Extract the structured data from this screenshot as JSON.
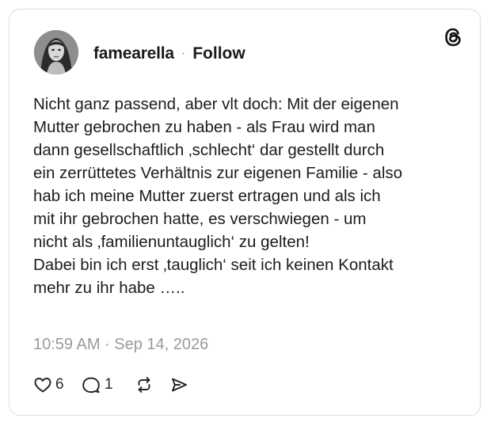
{
  "post": {
    "author": {
      "username": "famearella",
      "separator": "·",
      "follow_label": "Follow"
    },
    "platform_icon": "threads-logo-icon",
    "text": "Nicht ganz passend, aber vlt doch: Mit der eigenen\nMutter gebrochen zu haben - als Frau wird man\ndann gesellschaftlich ‚schlecht‘ dar gestellt durch\nein zerrüttetes Verhältnis zur eigenen Familie - also\nhab ich meine Mutter zuerst ertragen und als ich\nmit ihr gebrochen hatte, es verschwiegen - um\nnicht als ‚familienuntauglich‘ zu gelten!\nDabei bin ich erst ‚tauglich‘ seit ich keinen Kontakt\nmehr zu ihr habe …..",
    "timestamp": "10:59 AM · Sep 14, 2026",
    "actions": {
      "like": {
        "icon": "heart-icon",
        "count": "6"
      },
      "reply": {
        "icon": "comment-icon",
        "count": "1"
      },
      "repost": {
        "icon": "repost-icon"
      },
      "share": {
        "icon": "send-icon"
      }
    }
  }
}
